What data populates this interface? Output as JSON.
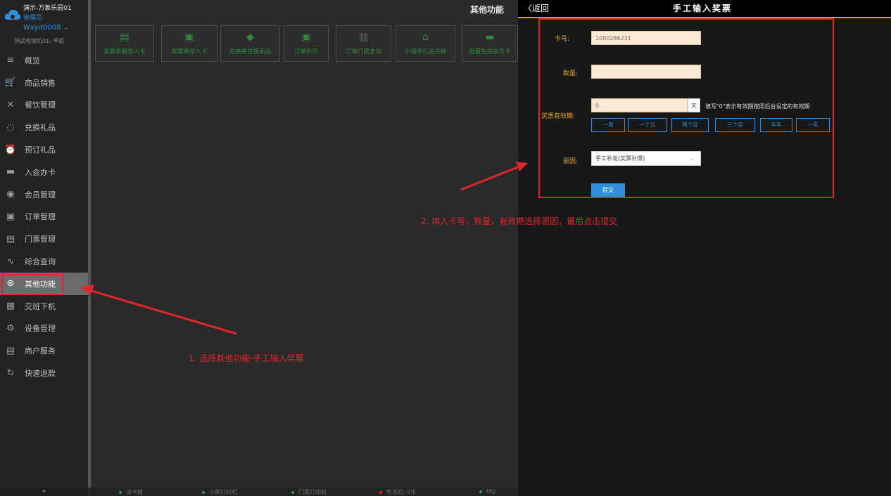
{
  "sidebar": {
    "store_name": "演示-万象乐园01",
    "role": "管理员",
    "user": "Wxyd0008 ⌄",
    "terminal": "测试收银机01: 早班",
    "items": [
      {
        "label": "概览",
        "icon": "list-icon"
      },
      {
        "label": "商品销售",
        "icon": "cart-icon"
      },
      {
        "label": "餐饮管理",
        "icon": "utensils-icon"
      },
      {
        "label": "兑换礼品",
        "icon": "gift-icon"
      },
      {
        "label": "预订礼品",
        "icon": "alarm-icon"
      },
      {
        "label": "入会办卡",
        "icon": "card-icon"
      },
      {
        "label": "会员管理",
        "icon": "member-icon"
      },
      {
        "label": "订单管理",
        "icon": "clipboard-icon"
      },
      {
        "label": "门票管理",
        "icon": "printer-icon"
      },
      {
        "label": "综合查询",
        "icon": "pulse-icon"
      },
      {
        "label": "其他功能",
        "icon": "dial-icon"
      },
      {
        "label": "交班下机",
        "icon": "calculator-icon"
      },
      {
        "label": "设备管理",
        "icon": "gear-icon"
      },
      {
        "label": "商户服务",
        "icon": "ledger-icon"
      },
      {
        "label": "快速退款",
        "icon": "refresh-icon"
      }
    ],
    "active_index": 10,
    "collapse_label": "«"
  },
  "main": {
    "title": "其他功能",
    "functions": [
      {
        "label": "奖票条解存入卡",
        "icon": "receipt-icon"
      },
      {
        "label": "奖票券存入卡",
        "icon": "ticket-icon"
      },
      {
        "label": "兑换券兑换商品",
        "icon": "tag-icon"
      },
      {
        "label": "订单补币",
        "icon": "clipboard-icon"
      },
      {
        "label": "订单门票查询",
        "icon": "book-icon"
      },
      {
        "label": "小程序礼品兑换",
        "icon": "basket-icon"
      },
      {
        "label": "批量生成会员卡",
        "icon": "card-icon"
      }
    ]
  },
  "status_bar": [
    {
      "label": "读卡器",
      "color": "#2e9e47"
    },
    {
      "label": "小票打印机",
      "color": "#2e9e47"
    },
    {
      "label": "门票打印机",
      "color": "#2e9e47"
    },
    {
      "label": "售币机: 0币",
      "color": "#e0262b"
    },
    {
      "label": "MQ",
      "color": "#2e9e47"
    }
  ],
  "panel": {
    "back_label": "〈返回",
    "title": "手工输入奖票",
    "card_label": "卡号:",
    "card_value": "1000266231",
    "qty_label": "数量:",
    "qty_value": "",
    "validity_label": "奖票有效期:",
    "validity_value": "0",
    "validity_unit": "天",
    "validity_hint": "填写\"0\"表示有效期按照后台设定的有效期",
    "periods": [
      "一周",
      "一个月",
      "两个月",
      "三个月",
      "半年",
      "一年"
    ],
    "reason_label": "原因:",
    "reason_value": "手工补发(奖票补偿)",
    "submit_label": "提交"
  },
  "annotations": {
    "step1": "1. 选择其他功能-手工输入奖票",
    "step2": "2. 填入卡号，数量，有效期选择原因，最后点击提交",
    "color": "#e0262b"
  }
}
